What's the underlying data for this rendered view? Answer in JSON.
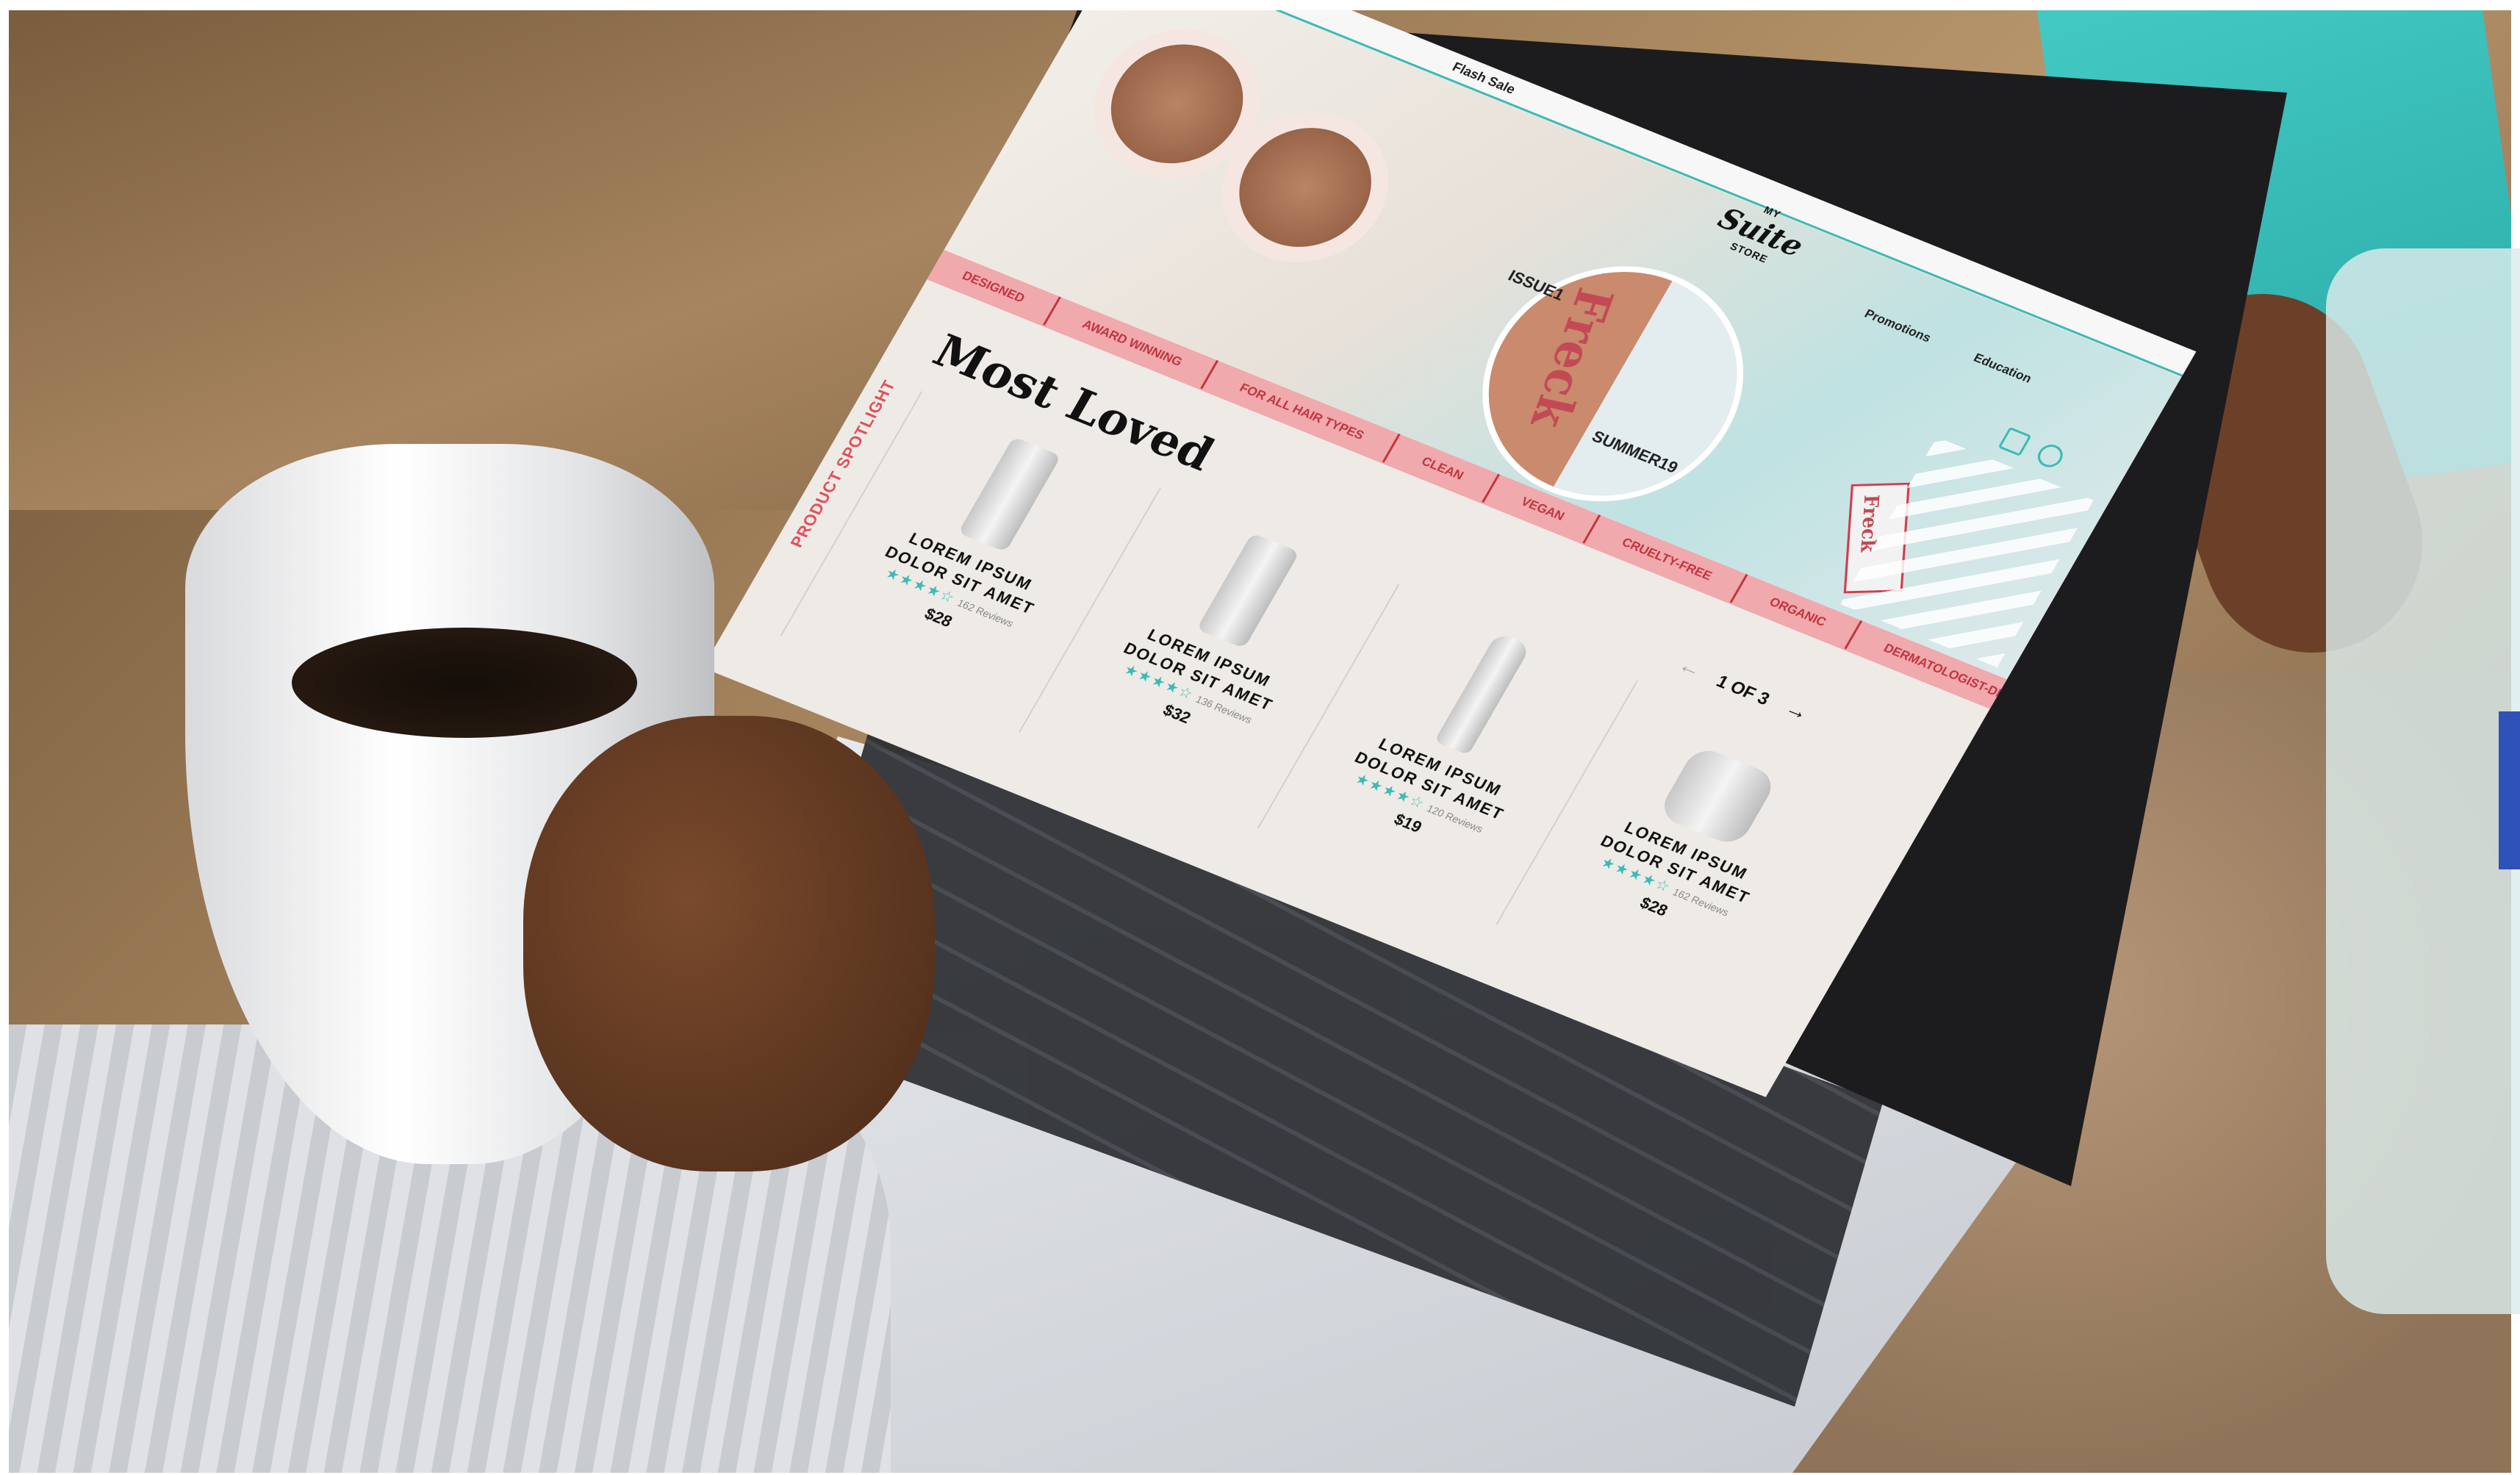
{
  "store": {
    "flash_sale": "Flash Sale",
    "brand_top": "MY",
    "brand_name": "Suite",
    "brand_bottom": "STORE",
    "nav": [
      "Promotions",
      "Education"
    ]
  },
  "hero": {
    "magazine_title": "Freck",
    "issue": "ISSUE1",
    "season": "SUMMER19",
    "product_label": "Freck"
  },
  "ticker": [
    "DESIGNED",
    "AWARD WINNING",
    "FOR ALL HAIR TYPES",
    "CLEAN",
    "VEGAN",
    "CRUELTY-FREE",
    "ORGANIC",
    "DERMATOLOGIST-DES"
  ],
  "section": {
    "title": "Most Loved",
    "side_label": "PRODUCT SPOTLIGHT"
  },
  "pager": {
    "label": "1 OF 3",
    "prev": "←",
    "next": "→"
  },
  "products": [
    {
      "name_line1": "LOREM IPSUM",
      "name_line2": "DOLOR SIT AMET",
      "stars": "★★★★☆",
      "reviews": "162 Reviews",
      "price": "$28"
    },
    {
      "name_line1": "LOREM IPSUM",
      "name_line2": "DOLOR SIT AMET",
      "stars": "★★★★☆",
      "reviews": "136 Reviews",
      "price": "$32"
    },
    {
      "name_line1": "LOREM IPSUM",
      "name_line2": "DOLOR SIT AMET",
      "stars": "★★★★☆",
      "reviews": "120 Reviews",
      "price": "$19"
    },
    {
      "name_line1": "LOREM IPSUM",
      "name_line2": "DOLOR SIT AMET",
      "stars": "★★★★☆",
      "reviews": "162 Reviews",
      "price": "$28"
    }
  ],
  "colors": {
    "accent_teal": "#3cbab6",
    "ticker_pink": "#f0a9ad",
    "ticker_text": "#c2343f",
    "overlay_blue": "#2f52b8"
  }
}
